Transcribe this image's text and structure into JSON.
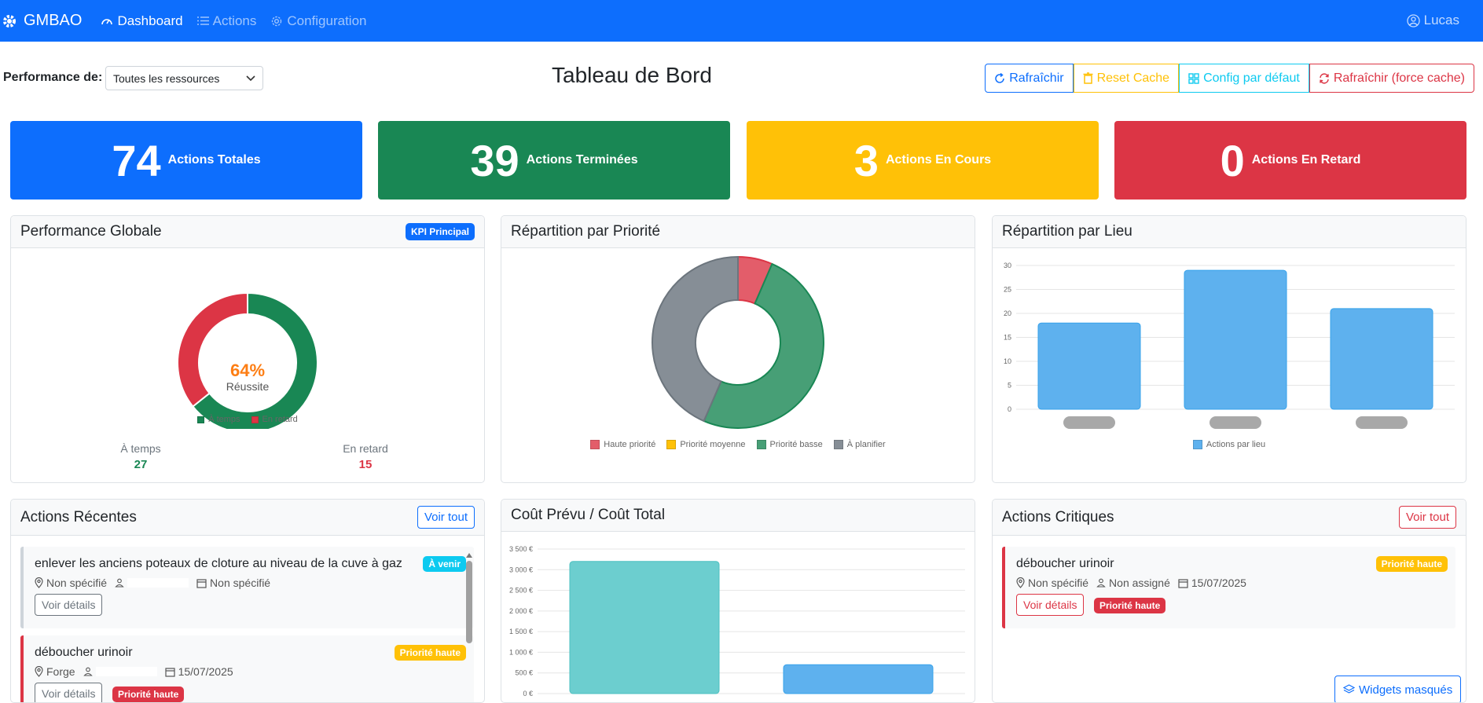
{
  "nav": {
    "brand": "GMBAO",
    "dashboard": "Dashboard",
    "actions": "Actions",
    "configuration": "Configuration",
    "user": "Lucas"
  },
  "toolbar": {
    "perf_label": "Performance de:",
    "perf_select": "Toutes les ressources",
    "title": "Tableau de Bord",
    "refresh": "Rafraîchir",
    "reset_cache": "Reset Cache",
    "default_config": "Config par défaut",
    "force_refresh": "Rafraîchir (force cache)"
  },
  "stats": [
    {
      "value": "74",
      "label": "Actions Totales",
      "color": "#0d6efd"
    },
    {
      "value": "39",
      "label": "Actions Terminées",
      "color": "#198754"
    },
    {
      "value": "3",
      "label": "Actions En Cours",
      "color": "#ffc107"
    },
    {
      "value": "0",
      "label": "Actions En Retard",
      "color": "#dc3545"
    }
  ],
  "performance": {
    "title": "Performance Globale",
    "badge": "KPI Principal",
    "percent": "64%",
    "subtitle": "Réussite",
    "legend_on_time": "À temps",
    "legend_late": "En retard",
    "on_time_label": "À temps",
    "on_time_value": "27",
    "late_label": "En retard",
    "late_value": "15"
  },
  "priority": {
    "title": "Répartition par Priorité",
    "legend": [
      "Haute priorité",
      "Priorité moyenne",
      "Priorité basse",
      "À planifier"
    ]
  },
  "location": {
    "title": "Répartition par Lieu",
    "legend": "Actions par lieu"
  },
  "recent": {
    "title": "Actions Récentes",
    "view_all": "Voir tout",
    "items": [
      {
        "title": "enlever les anciens poteaux de cloture au niveau de la cuve à gaz",
        "badge": "À venir",
        "location": "Non spécifié",
        "date": "Non spécifié",
        "details": "Voir détails"
      },
      {
        "title": "déboucher urinoir",
        "badge": "Priorité haute",
        "location": "Forge",
        "date": "15/07/2025",
        "details": "Voir détails",
        "badge2": "Priorité haute"
      }
    ]
  },
  "cost": {
    "title": "Coût Prévu / Coût Total"
  },
  "critical": {
    "title": "Actions Critiques",
    "view_all": "Voir tout",
    "item": {
      "title": "déboucher urinoir",
      "badge": "Priorité haute",
      "location": "Non spécifié",
      "assignee": "Non assigné",
      "date": "15/07/2025",
      "details": "Voir détails",
      "badge2": "Priorité haute"
    },
    "hidden_widgets": "Widgets masqués"
  },
  "chart_data": [
    {
      "type": "pie",
      "title": "Performance Globale",
      "labels": [
        "À temps",
        "En retard"
      ],
      "values": [
        27,
        15
      ],
      "colors": [
        "#198754",
        "#dc3545"
      ]
    },
    {
      "type": "pie",
      "title": "Répartition par Priorité",
      "labels": [
        "Haute priorité",
        "Priorité moyenne",
        "Priorité basse",
        "À planifier"
      ],
      "values": [
        3,
        0,
        23,
        20
      ],
      "colors": [
        "#dc3545",
        "#ffc107",
        "#198754",
        "#6c757d"
      ]
    },
    {
      "type": "bar",
      "title": "Répartition par Lieu",
      "categories": [
        "",
        "",
        ""
      ],
      "series": [
        {
          "name": "Actions par lieu",
          "values": [
            18,
            29,
            21
          ]
        }
      ],
      "ylim": [
        0,
        30
      ],
      "yticks": [
        0,
        5,
        10,
        15,
        20,
        25,
        30
      ],
      "grid": true,
      "legend": "bottom"
    },
    {
      "type": "bar",
      "title": "Coût Prévu / Coût Total",
      "categories": [
        "",
        ""
      ],
      "series": [
        {
          "values": [
            3200,
            700
          ]
        }
      ],
      "ylim": [
        0,
        3500
      ],
      "yticks": [
        "0 €",
        "500 €",
        "1 000 €",
        "1 500 €",
        "2 000 €",
        "2 500 €",
        "3 000 €",
        "3 500 €"
      ],
      "grid": true
    }
  ]
}
